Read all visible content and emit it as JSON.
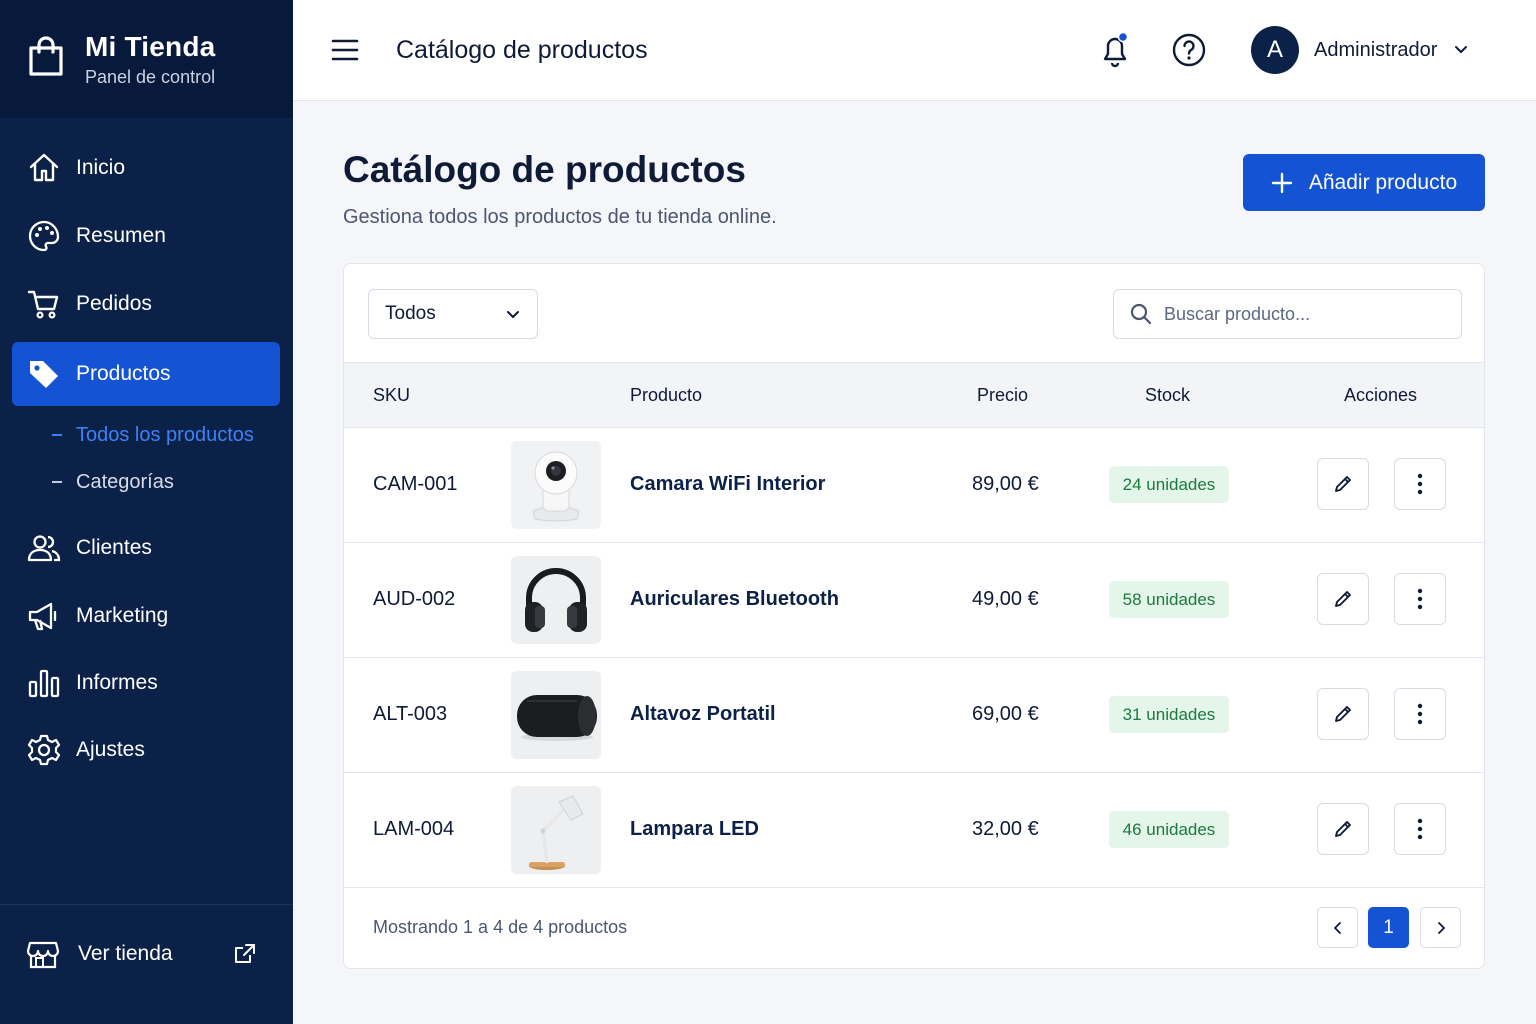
{
  "brand": {
    "title": "Mi Tienda",
    "subtitle": "Panel de control"
  },
  "sidebar": {
    "items": [
      {
        "label": "Inicio",
        "icon": "home-icon"
      },
      {
        "label": "Resumen",
        "icon": "palette-icon"
      },
      {
        "label": "Pedidos",
        "icon": "cart-icon"
      },
      {
        "label": "Productos",
        "icon": "tag-icon",
        "active": true
      },
      {
        "label": "Clientes",
        "icon": "users-icon"
      },
      {
        "label": "Marketing",
        "icon": "megaphone-icon"
      },
      {
        "label": "Informes",
        "icon": "bar-chart-icon"
      },
      {
        "label": "Ajustes",
        "icon": "gear-icon"
      }
    ],
    "subitems": [
      {
        "label": "Todos los productos",
        "active": true
      },
      {
        "label": "Categorías"
      }
    ],
    "view_store": "Ver tienda"
  },
  "topbar": {
    "title": "Catálogo de productos",
    "user_initial": "A",
    "user_name": "Administrador"
  },
  "page": {
    "title": "Catálogo de productos",
    "subtitle": "Gestiona todos los productos de tu tienda online.",
    "add_button": "Añadir producto"
  },
  "filters": {
    "selected": "Todos",
    "search_placeholder": "Buscar producto..."
  },
  "table": {
    "headers": {
      "sku": "SKU",
      "product": "Producto",
      "price": "Precio",
      "stock": "Stock",
      "actions": "Acciones"
    },
    "rows": [
      {
        "sku": "CAM-001",
        "name": "Camara WiFi Interior",
        "price": "89,00 €",
        "stock": "24 unidades",
        "image": "camera"
      },
      {
        "sku": "AUD-002",
        "name": "Auriculares Bluetooth",
        "price": "49,00 €",
        "stock": "58 unidades",
        "image": "headphones"
      },
      {
        "sku": "ALT-003",
        "name": "Altavoz Portatil",
        "price": "69,00 €",
        "stock": "31 unidades",
        "image": "speaker"
      },
      {
        "sku": "LAM-004",
        "name": "Lampara LED",
        "price": "32,00 €",
        "stock": "46 unidades",
        "image": "lamp"
      }
    ]
  },
  "pagination": {
    "summary": "Mostrando 1 a 4 de 4 productos",
    "current_page": "1"
  },
  "colors": {
    "sidebar": "#0c2148",
    "brand_bg": "#081a3c",
    "accent": "#1454d4",
    "badge_bg": "#e4f5ea",
    "badge_text": "#1b7a3d",
    "notification_dot": "#1454d4"
  }
}
